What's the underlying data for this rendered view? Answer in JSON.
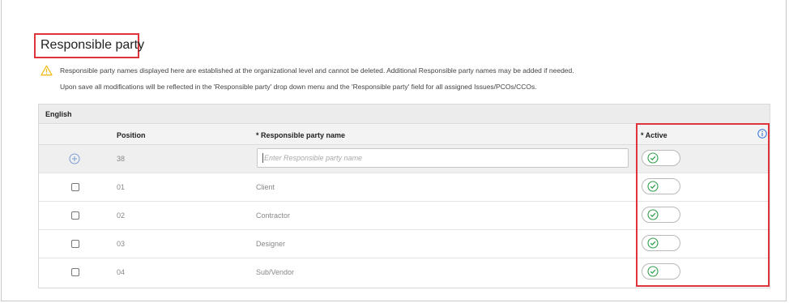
{
  "section": {
    "title": "Responsible party",
    "notice_line1": "Responsible party names displayed here are established at the organizational level and cannot be deleted. Additional Responsible party names may be added if needed.",
    "notice_line2": "Upon save all modifications will be reflected in the 'Responsible party' drop down menu and the 'Responsible party' field for all assigned Issues/PCOs/CCOs."
  },
  "table": {
    "language": "English",
    "headers": {
      "position": "Position",
      "name": "* Responsible party name",
      "active": "* Active"
    },
    "new_row": {
      "position": "38",
      "name_value": "",
      "name_placeholder": "Enter Responsible party name",
      "active": true
    },
    "rows": [
      {
        "position": "01",
        "name": "Client",
        "active": true
      },
      {
        "position": "02",
        "name": "Contractor",
        "active": true
      },
      {
        "position": "03",
        "name": "Designer",
        "active": true
      },
      {
        "position": "04",
        "name": "Sub/Vendor",
        "active": true
      }
    ]
  },
  "colors": {
    "highlight": "#e0343c",
    "toggle_check": "#2e9e4a",
    "info": "#2f6fd6",
    "warning": "#f2b705"
  },
  "icons": {
    "notice": "warning-triangle-icon",
    "add": "plus-circle-icon",
    "active": "check-circle-icon",
    "info": "info-icon"
  }
}
